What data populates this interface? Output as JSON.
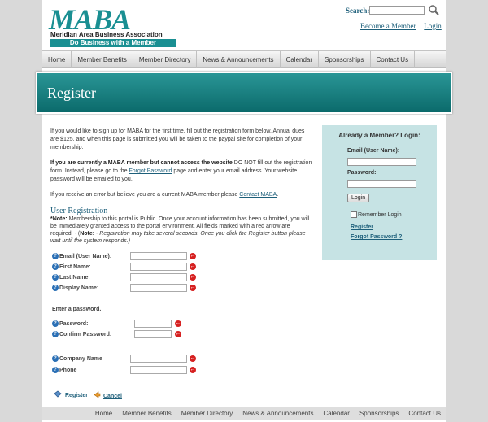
{
  "header": {
    "logo_text": "MABA",
    "logo_name": "Meridian Area Business Association",
    "logo_tagline": "Do Business with a Member",
    "search_label": "Search:",
    "search_placeholder": "",
    "become_member": "Become a Member",
    "separator": "|",
    "login": "Login"
  },
  "nav": {
    "items": [
      "Home",
      "Member Benefits",
      "Member Directory",
      "News & Announcements",
      "Calendar",
      "Sponsorships",
      "Contact Us"
    ]
  },
  "banner": {
    "title": "Register"
  },
  "content": {
    "p1": "If you would like to sign up for MABA for the first time, fill out the registration form below.  Annual dues are $125, and when this page is submitted you will be taken to the paypal site for completion of your membership.",
    "p2_bold": "If you are currently a MABA member but cannot access the website",
    "p2_a": " DO NOT fill out the registration form. Instead, please go to the ",
    "p2_link": "Forgot Password",
    "p2_b": " page and enter your email address. Your website password will be emailed to you.",
    "p3_a": "If you receive an error but believe you are a current MABA member please ",
    "p3_link": "Contact MABA",
    "p3_b": ".",
    "section_title": "User Registration",
    "note_bold": "*Note:",
    "note_text": " Membership to this portal is Public. Once your account information has been submitted, you will be immediately granted access to the portal environment. All fields marked with a red arrow are required. - (",
    "note_bold2": "Note:",
    "note_italic": " - Registration may take several seconds. Once you click the Register button please wait until the system responds.)"
  },
  "form": {
    "email_label": "Email (User Name):",
    "first_label": "First Name:",
    "last_label": "Last Name:",
    "display_label": "Display Name:",
    "enter_password": "Enter a password.",
    "password_label": "Password:",
    "confirm_label": "Confirm Password:",
    "company_label": "Company Name",
    "phone_label": "Phone",
    "register": "Register",
    "cancel": "Cancel",
    "help_glyph": "?",
    "required_glyph": "←"
  },
  "login_box": {
    "title": "Already a Member? Login:",
    "email_label": "Email (User Name):",
    "password_label": "Password:",
    "login_button": "Login",
    "remember": "Remember Login",
    "register_link": "Register",
    "forgot_link": "Forgot Password ?"
  },
  "footer": {
    "items": [
      "Home",
      "Member Benefits",
      "Member Directory",
      "News & Announcements",
      "Calendar",
      "Sponsorships",
      "Contact Us"
    ]
  },
  "colors": {
    "brand_teal": "#1a8f92",
    "link_blue": "#1d5f7a",
    "login_bg": "#c6e3e4",
    "required_red": "#d62020"
  }
}
